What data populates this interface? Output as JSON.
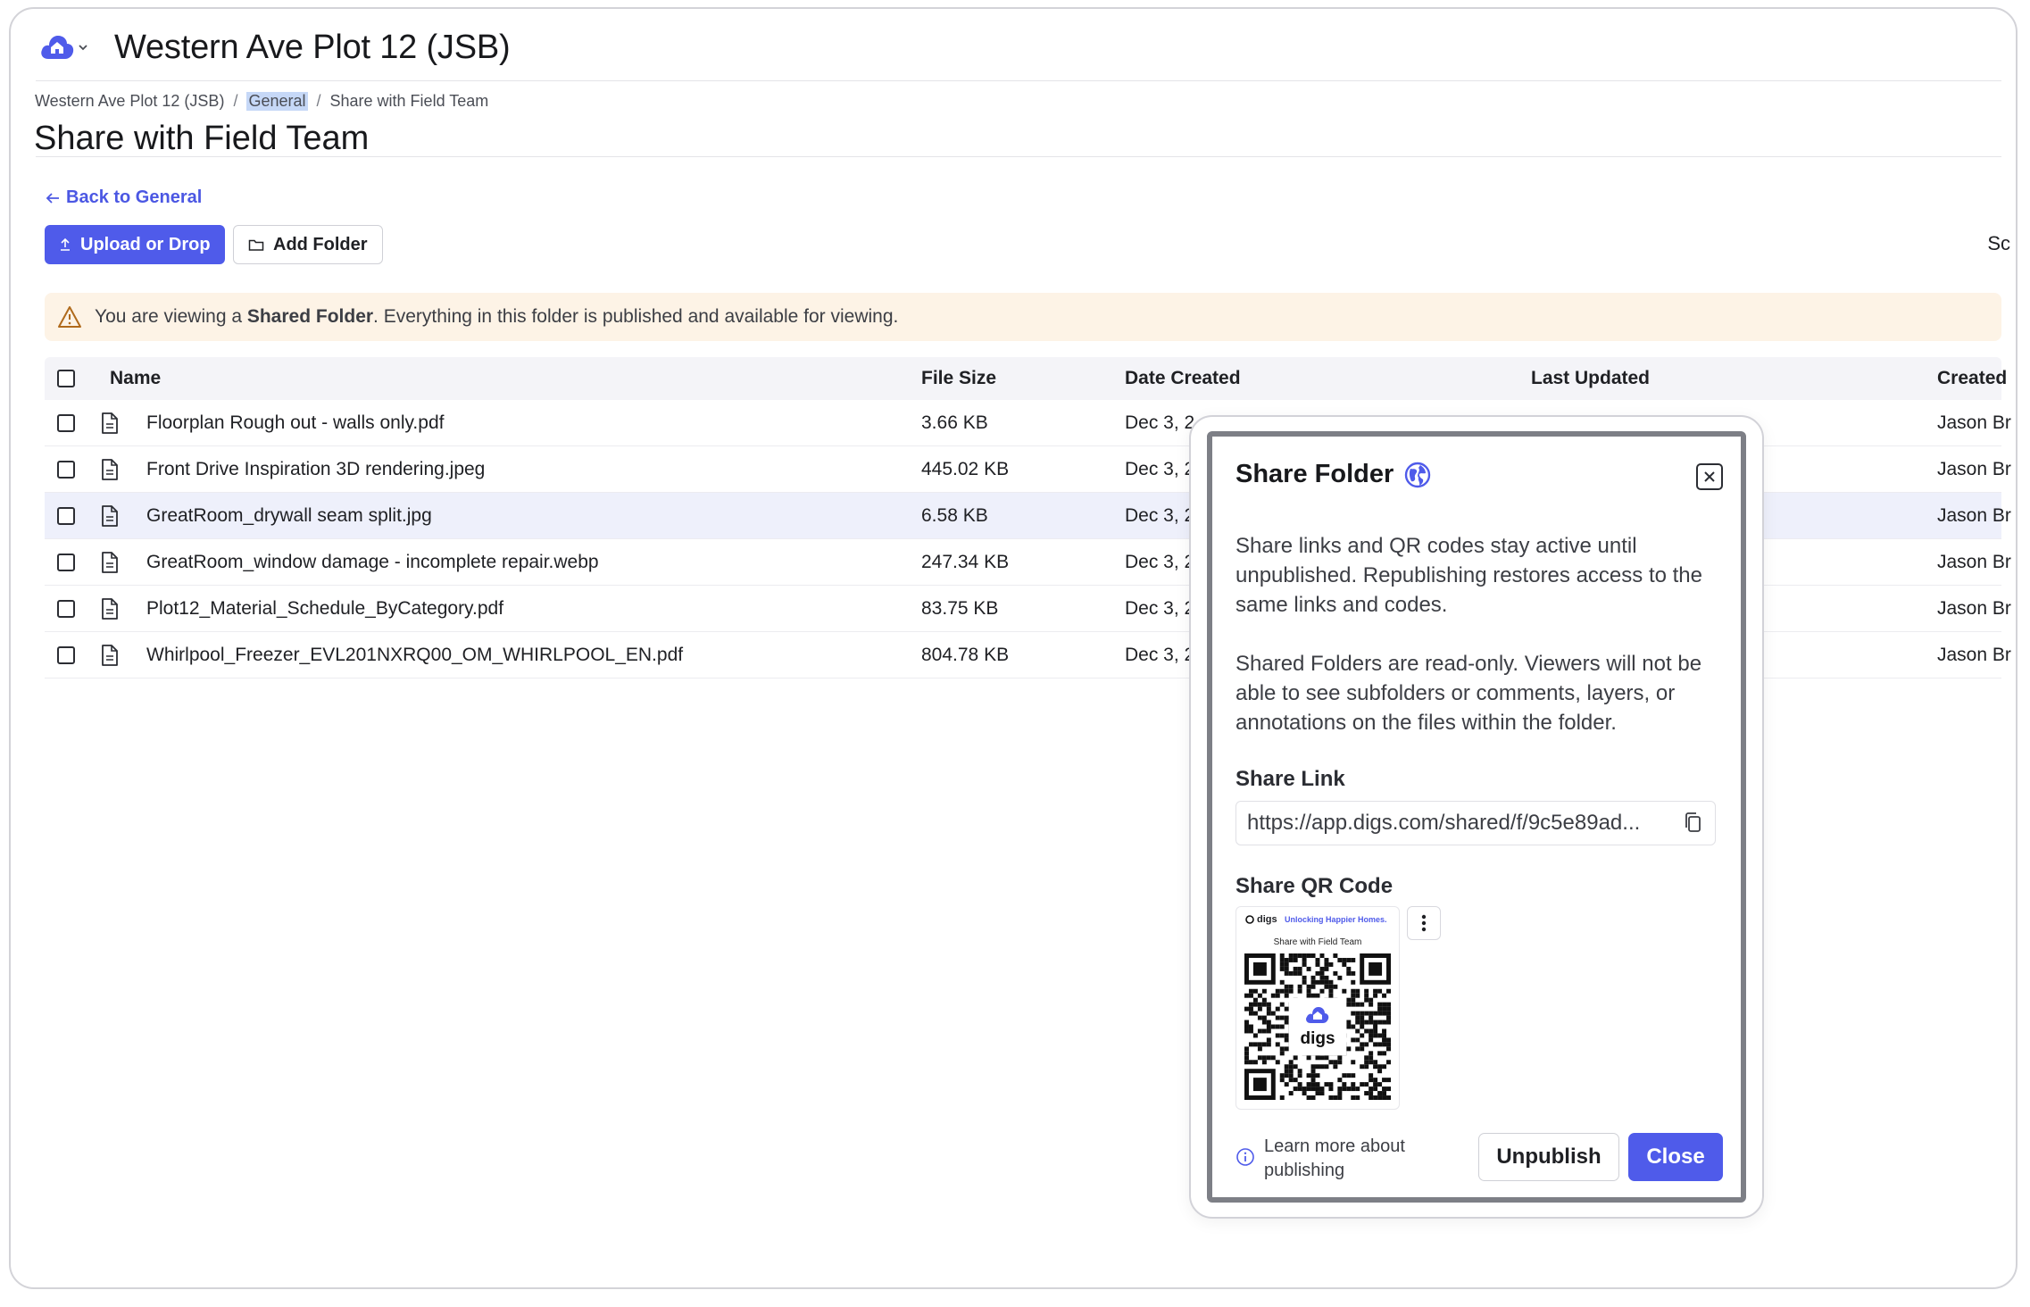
{
  "app": {
    "title": "Western Ave Plot 12 (JSB)",
    "logo_icon": "cloud-home-icon",
    "accent": "#4f5bea"
  },
  "breadcrumb": {
    "items": [
      "Western Ave Plot 12 (JSB)",
      "General",
      "Share with Field Team"
    ],
    "separator": "/"
  },
  "page": {
    "title": "Share with Field Team",
    "back_label": "Back to General"
  },
  "toolbar": {
    "upload_label": "Upload or Drop",
    "add_folder_label": "Add Folder",
    "search_partial": "Sc"
  },
  "alert": {
    "prefix": "You are viewing a ",
    "strong": "Shared Folder",
    "suffix": ". Everything in this folder is published and available for viewing."
  },
  "table": {
    "columns": [
      "Name",
      "File Size",
      "Date Created",
      "Last Updated",
      "Created"
    ],
    "rows": [
      {
        "name": "Floorplan Rough out - walls only.pdf",
        "size": "3.66 KB",
        "date": "Dec 3, 2",
        "creator": "Jason Br"
      },
      {
        "name": "Front Drive Inspiration 3D rendering.jpeg",
        "size": "445.02 KB",
        "date": "Dec 3, 2",
        "creator": "Jason Br"
      },
      {
        "name": "GreatRoom_drywall seam split.jpg",
        "size": "6.58 KB",
        "date": "Dec 3, 2",
        "creator": "Jason Br"
      },
      {
        "name": "GreatRoom_window damage - incomplete repair.webp",
        "size": "247.34 KB",
        "date": "Dec 3, 2",
        "creator": "Jason Br"
      },
      {
        "name": "Plot12_Material_Schedule_ByCategory.pdf",
        "size": "83.75 KB",
        "date": "Dec 3, 2",
        "creator": "Jason Br"
      },
      {
        "name": "Whirlpool_Freezer_EVL201NXRQ00_OM_WHIRLPOOL_EN.pdf",
        "size": "804.78 KB",
        "date": "Dec 3, 2",
        "creator": "Jason Br"
      }
    ]
  },
  "modal": {
    "title": "Share Folder",
    "p1": "Share links and QR codes stay active until unpublished. Republishing restores access to the same links and codes.",
    "p2": "Shared Folders are read-only. Viewers will not be able to see subfolders or comments, layers, or annotations on the files within the folder.",
    "link_label": "Share Link",
    "link_value": "https://app.digs.com/shared/f/9c5e89ad...",
    "qr_label": "Share QR Code",
    "qr_brand": "digs",
    "qr_tagline": "Unlocking Happier Homes.",
    "qr_folder": "Share with Field Team",
    "qr_center_brand": "digs",
    "learn_more": "Learn more about publishing",
    "unpublish_label": "Unpublish",
    "close_label": "Close"
  }
}
